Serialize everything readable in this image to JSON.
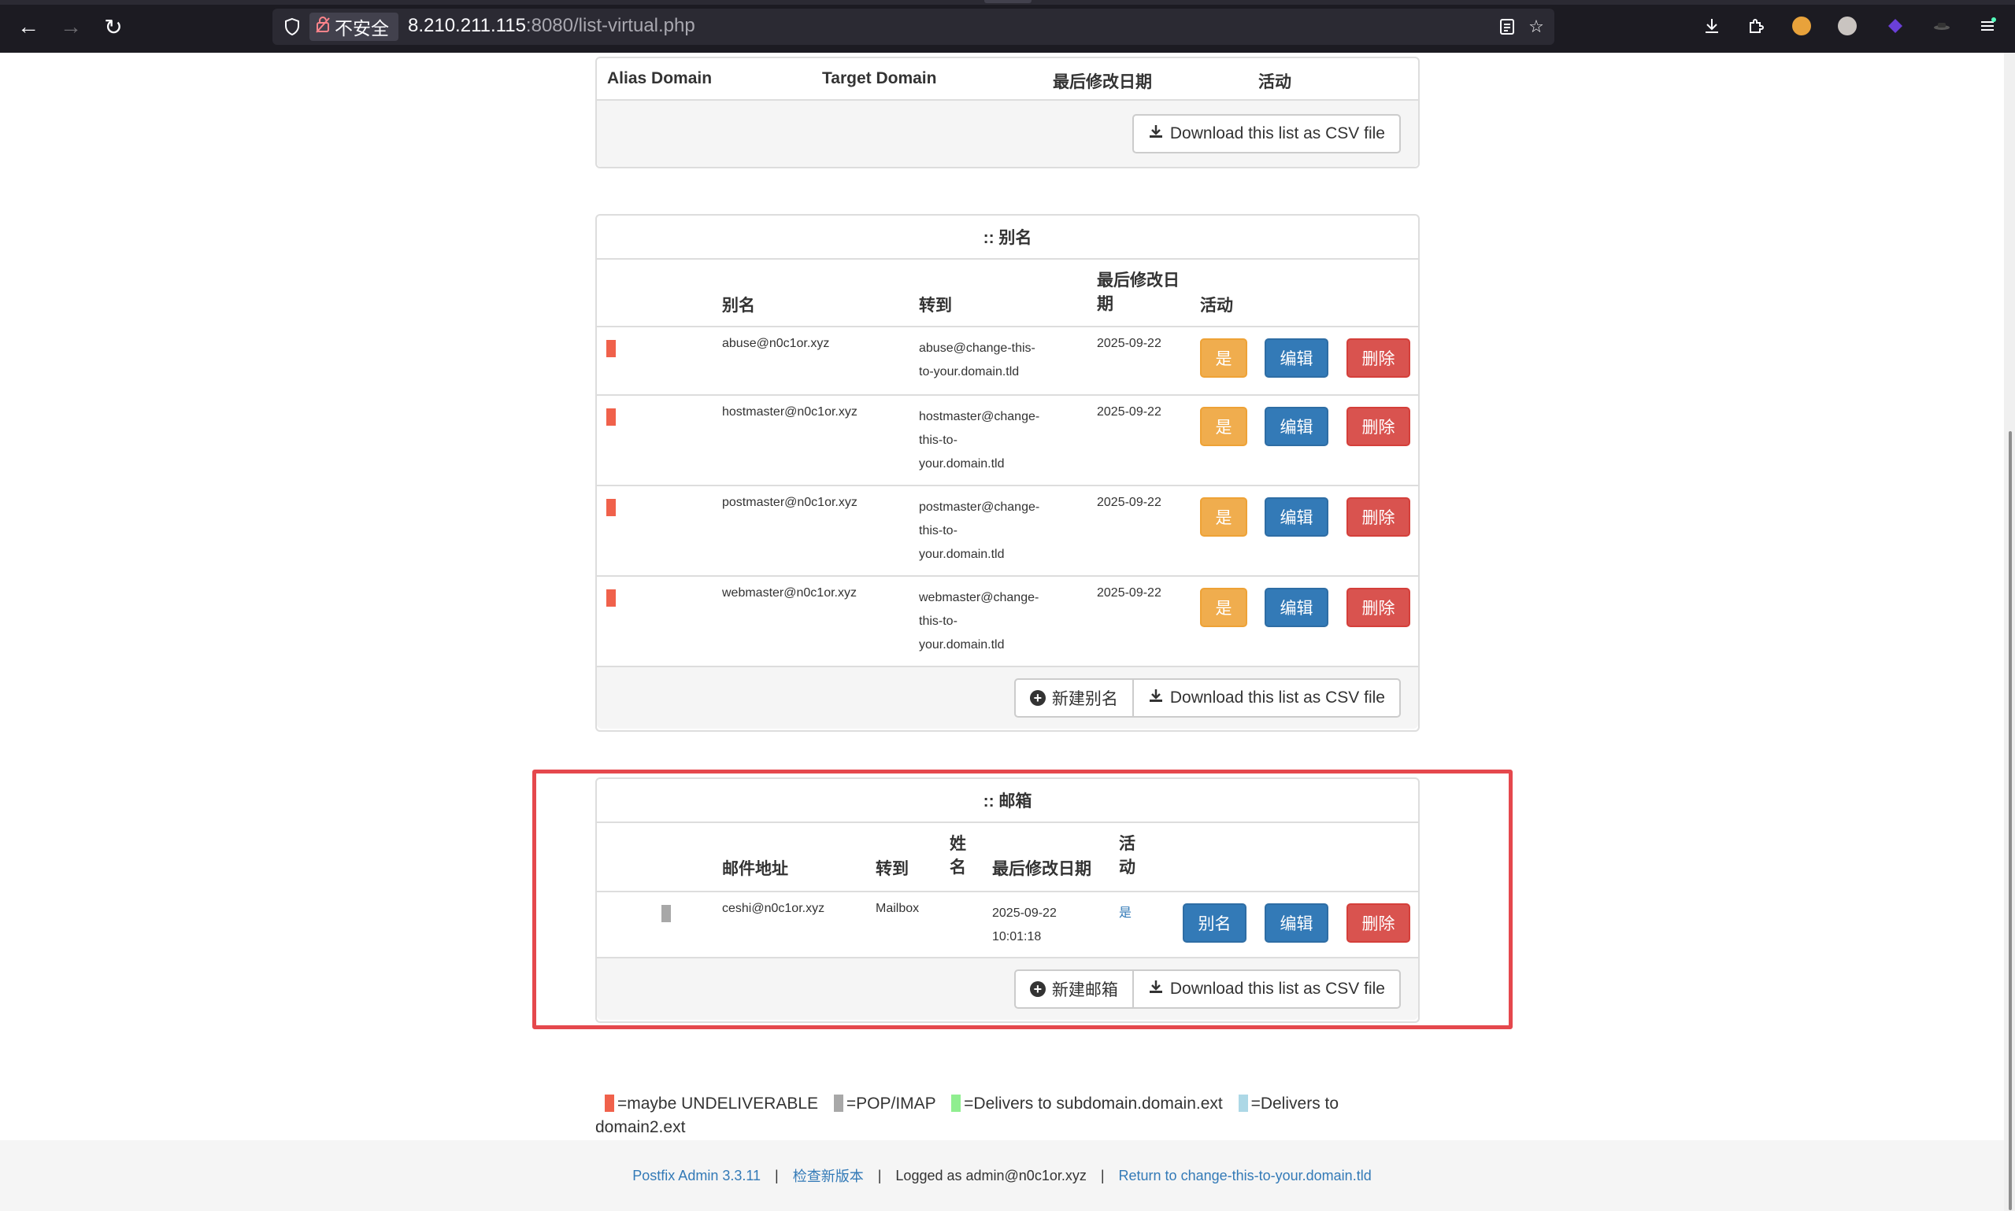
{
  "browser": {
    "insecure_label": "不安全",
    "url_host": "8.210.211.115",
    "url_rest": ":8080/list-virtual.php"
  },
  "alias_domain": {
    "columns": [
      "Alias Domain",
      "Target Domain",
      "最后修改日期",
      "活动"
    ],
    "download_label": "Download this list as CSV file"
  },
  "aliases": {
    "title": ":: 别名",
    "col_alias": "别名",
    "col_goto": "转到",
    "col_modified": "最后修改日期",
    "col_active": "活动",
    "rows": [
      {
        "alias": "abuse@n0c1or.xyz",
        "goto": [
          "abuse@change-this-",
          "to-your.domain.tld"
        ],
        "modified": "2025-09-22",
        "active": "是",
        "edit": "编辑",
        "delete": "删除"
      },
      {
        "alias": "hostmaster@n0c1or.xyz",
        "goto": [
          "hostmaster@change-",
          "this-to-",
          "your.domain.tld"
        ],
        "modified": "2025-09-22",
        "active": "是",
        "edit": "编辑",
        "delete": "删除"
      },
      {
        "alias": "postmaster@n0c1or.xyz",
        "goto": [
          "postmaster@change-",
          "this-to-",
          "your.domain.tld"
        ],
        "modified": "2025-09-22",
        "active": "是",
        "edit": "编辑",
        "delete": "删除"
      },
      {
        "alias": "webmaster@n0c1or.xyz",
        "goto": [
          "webmaster@change-",
          "this-to-",
          "your.domain.tld"
        ],
        "modified": "2025-09-22",
        "active": "是",
        "edit": "编辑",
        "delete": "删除"
      }
    ],
    "new_label": "新建别名",
    "download_label": "Download this list as CSV file"
  },
  "mailboxes": {
    "title": ":: 邮箱",
    "col_email": "邮件地址",
    "col_goto": "转到",
    "col_name": "姓名",
    "col_modified": "最后修改日期",
    "col_active": "活动",
    "rows": [
      {
        "email": "ceshi@n0c1or.xyz",
        "goto": "Mailbox",
        "name": "",
        "modified_date": "2025-09-22",
        "modified_time": "10:01:18",
        "active": "是",
        "alias": "别名",
        "edit": "编辑",
        "delete": "删除"
      }
    ],
    "new_label": "新建邮箱",
    "download_label": "Download this list as CSV file"
  },
  "legend": {
    "undeliverable": "=maybe UNDELIVERABLE",
    "popimap": "=POP/IMAP",
    "subdomain": "=Delivers to subdomain.domain.ext",
    "domain2": "=Delivers to domain2.ext"
  },
  "footer": {
    "version": "Postfix Admin 3.3.11",
    "check_update": "检查新版本",
    "logged_as": "Logged as admin@n0c1or.xyz",
    "return_link": "Return to change-this-to-your.domain.tld"
  },
  "colors": {
    "undeliverable": "#f0614b",
    "popimap": "#a8a8a8",
    "subdomain": "#90ee90",
    "domain2": "#add8e6",
    "highlight": "#e5484d"
  }
}
